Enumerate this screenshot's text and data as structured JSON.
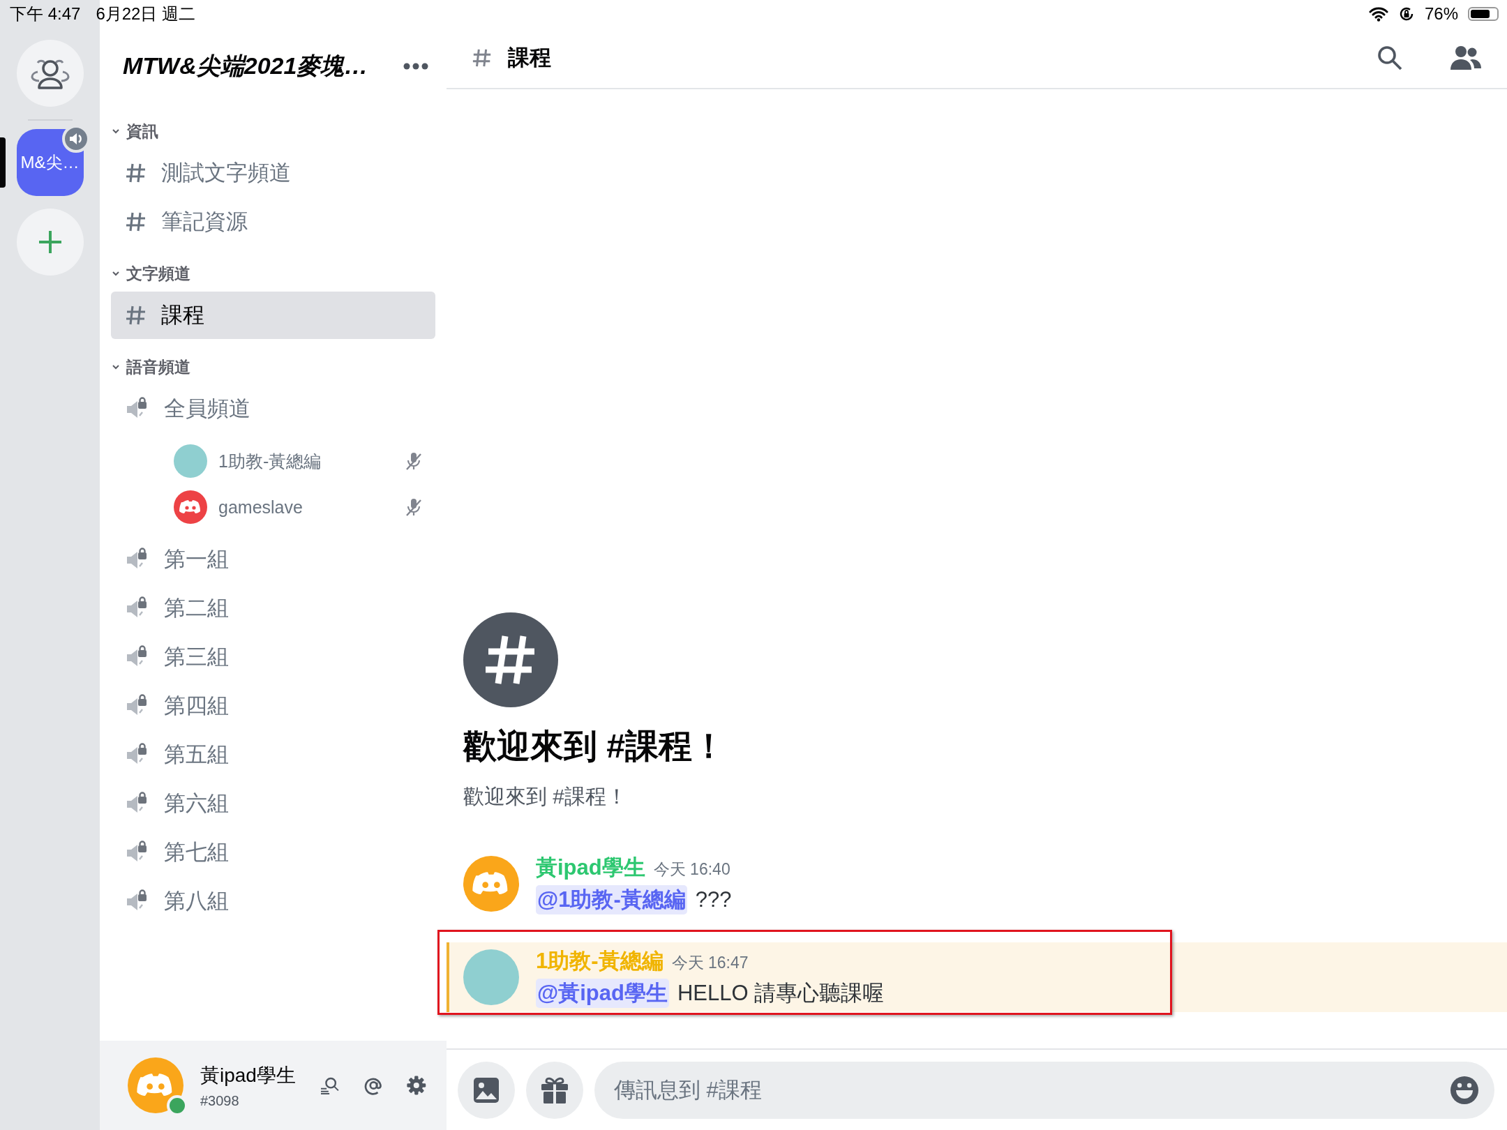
{
  "status_bar": {
    "time": "下午 4:47",
    "date": "6月22日 週二",
    "battery": "76%"
  },
  "server_rail": {
    "servers": [
      {
        "label": "M&尖…",
        "selected": true,
        "voice_active": true
      }
    ]
  },
  "sidebar": {
    "server_name": "MTW&尖端2021麥塊…",
    "categories": [
      {
        "name": "資訊",
        "expanded": true,
        "channels": [
          {
            "kind": "text",
            "name": "測試文字頻道",
            "selected": false
          },
          {
            "kind": "text",
            "name": "筆記資源",
            "selected": false
          }
        ]
      },
      {
        "name": "文字頻道",
        "expanded": true,
        "channels": [
          {
            "kind": "text",
            "name": "課程",
            "selected": true
          }
        ]
      },
      {
        "name": "語音頻道",
        "expanded": true,
        "channels": [
          {
            "kind": "voice",
            "name": "全員頻道",
            "selected": false,
            "members": [
              {
                "name": "1助教-黃總編",
                "avatar": {
                  "kind": "photo"
                },
                "muted": true
              },
              {
                "name": "gameslave",
                "avatar": {
                  "kind": "logo",
                  "color": "#ed4245"
                },
                "muted": true
              }
            ]
          },
          {
            "kind": "voice",
            "name": "第一組",
            "selected": false
          },
          {
            "kind": "voice",
            "name": "第二組",
            "selected": false
          },
          {
            "kind": "voice",
            "name": "第三組",
            "selected": false
          },
          {
            "kind": "voice",
            "name": "第四組",
            "selected": false
          },
          {
            "kind": "voice",
            "name": "第五組",
            "selected": false
          },
          {
            "kind": "voice",
            "name": "第六組",
            "selected": false
          },
          {
            "kind": "voice",
            "name": "第七組",
            "selected": false
          },
          {
            "kind": "voice",
            "name": "第八組",
            "selected": false
          }
        ]
      }
    ]
  },
  "user_panel": {
    "name": "黃ipad學生",
    "tag": "#3098",
    "online": true
  },
  "header": {
    "channel": "課程"
  },
  "welcome": {
    "title": "歡迎來到 #課程！",
    "subtitle": "歡迎來到 #課程！"
  },
  "messages": [
    {
      "author": {
        "name": "黃ipad學生",
        "color": "#2dc770"
      },
      "avatar": {
        "kind": "logo",
        "color": "#faa61a"
      },
      "time": "今天 16:40",
      "mention": "@1助教-黃總編",
      "text": "???",
      "highlighted": false,
      "annotated": false
    },
    {
      "author": {
        "name": "1助教-黃總編",
        "color": "#f0b400"
      },
      "avatar": {
        "kind": "photo"
      },
      "time": "今天 16:47",
      "mention": "@黃ipad學生",
      "text": "HELLO 請專心聽課喔",
      "highlighted": true,
      "annotated": true
    }
  ],
  "composer": {
    "placeholder": "傳訊息到 #課程"
  }
}
